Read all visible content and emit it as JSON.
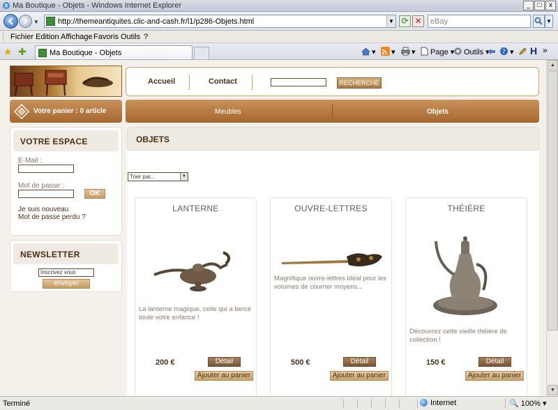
{
  "window": {
    "title": "Ma Boutique - Objets - Windows Internet Explorer",
    "buttons": [
      "_",
      "□",
      "x"
    ]
  },
  "address": {
    "url": "http://themeantiquites.clic-and-cash.fr/l1/p286-Objets.html",
    "search_placeholder": "eBay"
  },
  "menu": [
    "Fichier",
    "Edition",
    "Affichage",
    "Favoris",
    "Outils",
    "?"
  ],
  "tab": {
    "label": "Ma Boutique - Objets"
  },
  "commands": {
    "page": "Page",
    "tools": "Outils"
  },
  "site": {
    "nav": {
      "home": "Accueil",
      "contact": "Contact",
      "search_button": "RECHERCHE"
    },
    "cart": "Votre panier : 0 article",
    "categories": [
      "Meubles",
      "Objets"
    ],
    "account": {
      "heading": "VOTRE ESPACE",
      "email_label": "E-Mail :",
      "password_label": "Mot de passe :",
      "ok": "OK",
      "new_user": "Je suis nouveau",
      "forgot": "Mot de passe perdu ?"
    },
    "newsletter": {
      "heading": "NEWSLETTER",
      "input_value": "Inscrivez vous",
      "button": "envoyer"
    },
    "main": {
      "heading": "OBJETS",
      "sort_label": "Trier par...",
      "detail_label": "Détail",
      "add_label": "Ajouter au panier"
    },
    "products": [
      {
        "name": "LANTERNE",
        "description": "La lanterne magique, celle qui a bercé toute votre enfance !",
        "price": "200 €"
      },
      {
        "name": "OUVRE-LETTRES",
        "description": "Magnifique ouvre-lettres idéal pour les volumes de courrier moyens...",
        "price": "500 €"
      },
      {
        "name": "THÉIÈRE",
        "description": "Découvrez cette vieille théière de collection !",
        "price": "150 €"
      }
    ]
  },
  "status": {
    "text": "Terminé",
    "zone": "Internet",
    "zoom": "100%"
  }
}
